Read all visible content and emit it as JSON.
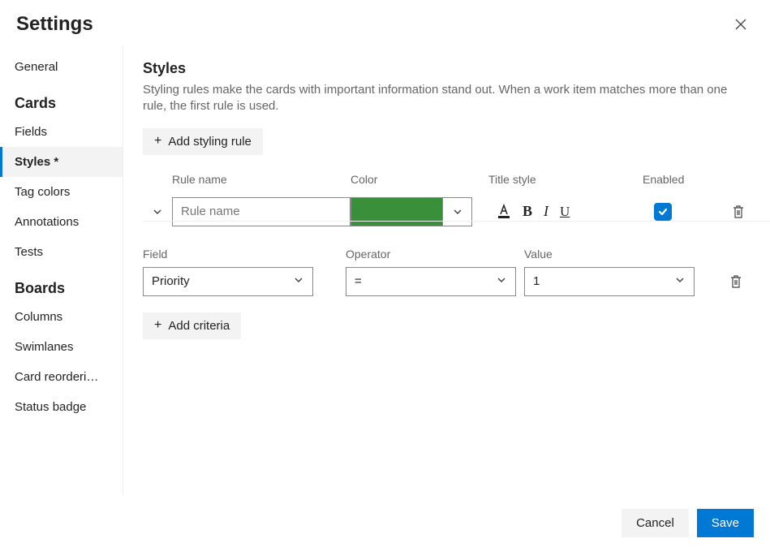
{
  "header": {
    "title": "Settings"
  },
  "sidebar": {
    "items": [
      {
        "label": "General",
        "group": null
      },
      {
        "label": "Cards",
        "group": "head"
      },
      {
        "label": "Fields",
        "group": null
      },
      {
        "label": "Styles *",
        "group": null,
        "active": true
      },
      {
        "label": "Tag colors",
        "group": null
      },
      {
        "label": "Annotations",
        "group": null
      },
      {
        "label": "Tests",
        "group": null
      },
      {
        "label": "Boards",
        "group": "head"
      },
      {
        "label": "Columns",
        "group": null
      },
      {
        "label": "Swimlanes",
        "group": null
      },
      {
        "label": "Card reorderi…",
        "group": null
      },
      {
        "label": "Status badge",
        "group": null
      }
    ]
  },
  "main": {
    "title": "Styles",
    "description": "Styling rules make the cards with important information stand out. When a work item matches more than one rule, the first rule is used.",
    "add_rule_label": "Add styling rule",
    "columns": {
      "rule_name": "Rule name",
      "color": "Color",
      "title_style": "Title style",
      "enabled": "Enabled"
    },
    "rule": {
      "name_placeholder": "Rule name",
      "name_value": "",
      "color": "#3a8f3a",
      "enabled": true
    },
    "criteria_columns": {
      "field": "Field",
      "operator": "Operator",
      "value": "Value"
    },
    "criteria": {
      "field": "Priority",
      "operator": "=",
      "value": "1"
    },
    "add_criteria_label": "Add criteria"
  },
  "footer": {
    "cancel": "Cancel",
    "save": "Save"
  },
  "icons": {
    "close": "close-icon",
    "plus": "plus-icon",
    "chevron_down": "chevron-down-icon",
    "font_color": "font-color-icon",
    "bold": "bold-icon",
    "italic": "italic-icon",
    "underline": "underline-icon",
    "check": "check-icon",
    "trash": "trash-icon"
  }
}
